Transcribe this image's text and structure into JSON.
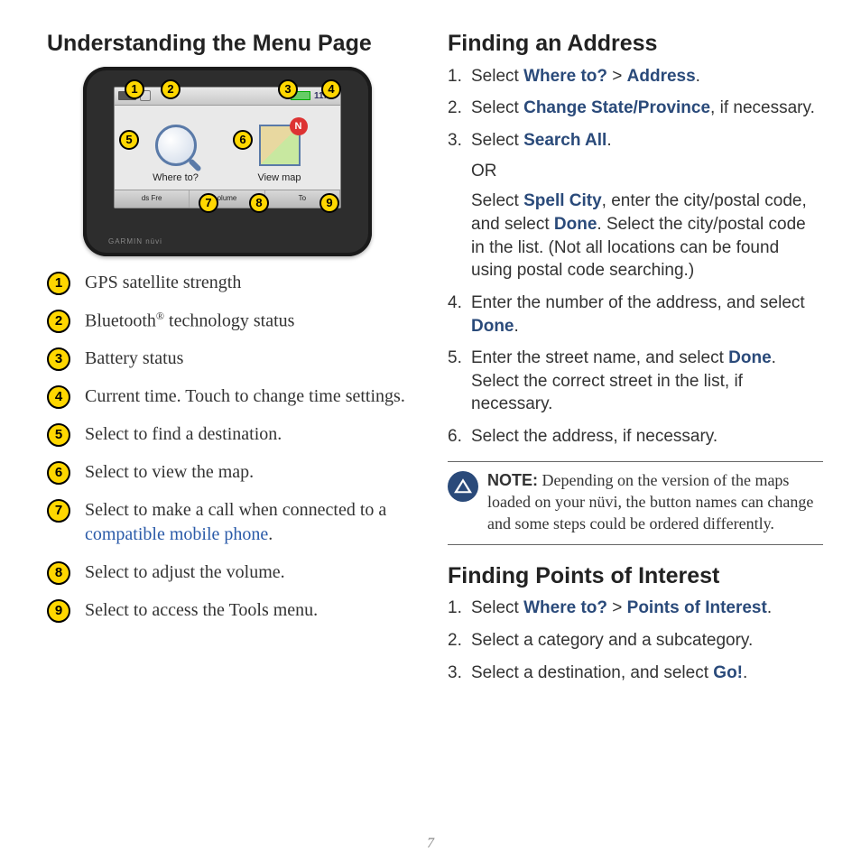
{
  "page_number": "7",
  "left": {
    "heading": "Understanding the Menu Page",
    "device": {
      "time": "11:24",
      "where_to": "Where to?",
      "view_map": "View map",
      "brand": "GARMIN nüvi",
      "bottom": {
        "a": "ds Fre",
        "b": "olume",
        "c": "To"
      }
    },
    "callouts": [
      "➊",
      "➋",
      "➌",
      "➍",
      "➎",
      "➏",
      "➐",
      "➑",
      "➒"
    ],
    "legend": [
      {
        "n": "➊",
        "text": "GPS satellite strength"
      },
      {
        "n": "➋",
        "text_html": "Bluetooth<sup>®</sup> technology status"
      },
      {
        "n": "➌",
        "text": "Battery status"
      },
      {
        "n": "➍",
        "text": "Current time. Touch to change time settings."
      },
      {
        "n": "➎",
        "text": "Select to find a destination."
      },
      {
        "n": "➏",
        "text": "Select to view the map."
      },
      {
        "n": "➐",
        "text_pre": "Select to make a call when connected to a ",
        "link": "compatible mobile phone",
        "text_post": "."
      },
      {
        "n": "➑",
        "text": "Select to adjust the volume."
      },
      {
        "n": "➒",
        "text": "Select to access the Tools menu."
      }
    ]
  },
  "right": {
    "addr_heading": "Finding an Address",
    "addr_steps": {
      "s1_pre": "Select ",
      "s1_a": "Where to?",
      "s1_gt": " > ",
      "s1_b": "Address",
      "s1_post": ".",
      "s2_pre": "Select ",
      "s2_a": "Change State/Province",
      "s2_post": ", if necessary.",
      "s3_pre": "Select ",
      "s3_a": "Search All",
      "s3_post": ".",
      "s3_or": "OR",
      "s3b_pre": "Select ",
      "s3b_a": "Spell City",
      "s3b_mid": ", enter the city/postal code, and select ",
      "s3b_b": "Done",
      "s3b_post": ". Select the city/postal code in the list. (Not all locations can be found using postal code searching.)",
      "s4_pre": "Enter the number of the address, and select ",
      "s4_a": "Done",
      "s4_post": ".",
      "s5_pre": "Enter the street name, and select ",
      "s5_a": "Done",
      "s5_post": ". Select the correct street in the list, if necessary.",
      "s6": "Select the address, if necessary."
    },
    "note_label": "NOTE:",
    "note_text": " Depending on the version of the maps loaded on your nüvi, the button names can change and some steps could be ordered differently.",
    "poi_heading": "Finding Points of Interest",
    "poi_steps": {
      "s1_pre": "Select ",
      "s1_a": "Where to?",
      "s1_gt": " > ",
      "s1_b": "Points of Interest",
      "s1_post": ".",
      "s2": "Select a category and a subcategory.",
      "s3_pre": "Select a destination, and select ",
      "s3_a": "Go!",
      "s3_post": "."
    }
  }
}
